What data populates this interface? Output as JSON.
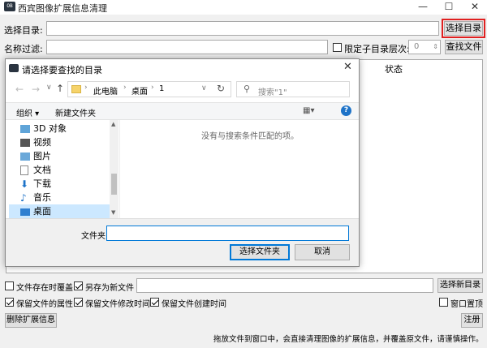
{
  "window": {
    "title": "西宾图像扩展信息清理",
    "app_icon_text": "OB",
    "controls": {
      "minimize": "—",
      "maximize": "☐",
      "close": "✕"
    }
  },
  "top": {
    "dir_label": "选择目录:",
    "dir_value": "",
    "dir_button": "选择目录",
    "name_filter_label": "名称过滤:",
    "name_filter_value": "",
    "limit_depth_label": "限定子目录层次:",
    "limit_depth_checked": false,
    "depth_value": "0",
    "find_button": "查找文件",
    "status_column": "状态"
  },
  "dialog": {
    "title": "请选择要查找的目录",
    "breadcrumb": [
      "此电脑",
      "桌面",
      "1"
    ],
    "search_placeholder": "搜索\"1\"",
    "organize_label": "组织 ▾",
    "new_folder_label": "新建文件夹",
    "tree": [
      {
        "label": "3D 对象",
        "icon": "3d-objects-icon"
      },
      {
        "label": "视频",
        "icon": "video-icon"
      },
      {
        "label": "图片",
        "icon": "pictures-icon"
      },
      {
        "label": "文档",
        "icon": "documents-icon"
      },
      {
        "label": "下载",
        "icon": "download-icon"
      },
      {
        "label": "音乐",
        "icon": "music-icon"
      },
      {
        "label": "桌面",
        "icon": "desktop-icon",
        "selected": true
      }
    ],
    "empty_message": "没有与搜索条件匹配的项。",
    "folder_label": "文件夹:",
    "folder_value": "",
    "select_button": "选择文件夹",
    "cancel_button": "取消"
  },
  "bottom": {
    "overwrite_label": "文件存在时覆盖",
    "overwrite_checked": false,
    "saveas_label": "另存为新文件",
    "saveas_checked": true,
    "new_dir_value": "",
    "new_dir_button": "选择新目录",
    "keep_attr_label": "保留文件的属性",
    "keep_attr_checked": true,
    "keep_mtime_label": "保留文件修改时间",
    "keep_mtime_checked": true,
    "keep_ctime_label": "保留文件创建时间",
    "keep_ctime_checked": true,
    "topmost_label": "窗口置顶",
    "topmost_checked": false,
    "delete_ext_button": "删除扩展信息",
    "register_button": "注册",
    "hint": "拖放文件到窗口中，会直接清理图像的扩展信息，并覆盖原文件，请谨慎操作。"
  }
}
